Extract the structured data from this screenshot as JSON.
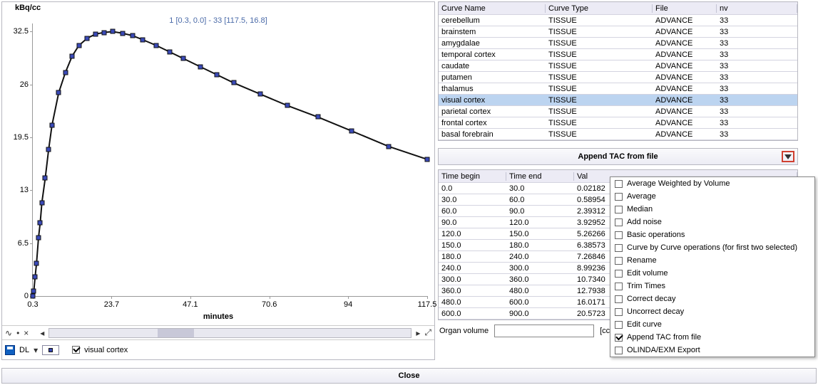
{
  "chart_data": {
    "type": "line",
    "title": "",
    "subtitle": "1 [0.3, 0.0] - 33 [117.5, 16.8]",
    "xlabel": "minutes",
    "ylabel": "kBq/cc",
    "xticks": [
      0.3,
      23.7,
      47.1,
      70.6,
      94.0,
      117.5
    ],
    "yticks": [
      0.0,
      6.5,
      13.0,
      19.5,
      26.0,
      32.5
    ],
    "xlim": [
      0.3,
      117.5
    ],
    "ylim": [
      0.0,
      33.5
    ],
    "series": [
      {
        "name": "visual cortex",
        "x": [
          0.3,
          0.6,
          1.0,
          1.4,
          2.0,
          2.5,
          3.0,
          4.0,
          5.0,
          6.0,
          8.0,
          10.0,
          12.0,
          14.0,
          16.5,
          19.0,
          21.5,
          24.0,
          27.0,
          30.0,
          33.0,
          37.0,
          41.0,
          45.0,
          50.0,
          55.0,
          60.0,
          68.0,
          76.0,
          85.0,
          95.0,
          106.0,
          117.5
        ],
        "y": [
          0.0,
          0.6,
          2.4,
          4.0,
          7.2,
          9.0,
          11.5,
          14.5,
          18.0,
          21.0,
          25.0,
          27.5,
          29.5,
          30.8,
          31.7,
          32.2,
          32.4,
          32.5,
          32.3,
          32.0,
          31.5,
          30.8,
          30.0,
          29.2,
          28.2,
          27.2,
          26.2,
          24.8,
          23.4,
          22.0,
          20.3,
          18.4,
          16.8
        ]
      }
    ]
  },
  "legend": {
    "series_label": "visual cortex",
    "dl_label": "DL"
  },
  "curves_table": {
    "headers": [
      "Curve Name",
      "Curve Type",
      "File",
      "nv"
    ],
    "rows": [
      {
        "name": "cerebellum",
        "type": "TISSUE",
        "file": "ADVANCE",
        "nv": "33",
        "sel": false
      },
      {
        "name": "brainstem",
        "type": "TISSUE",
        "file": "ADVANCE",
        "nv": "33",
        "sel": false
      },
      {
        "name": "amygdalae",
        "type": "TISSUE",
        "file": "ADVANCE",
        "nv": "33",
        "sel": false
      },
      {
        "name": "temporal cortex",
        "type": "TISSUE",
        "file": "ADVANCE",
        "nv": "33",
        "sel": false
      },
      {
        "name": "caudate",
        "type": "TISSUE",
        "file": "ADVANCE",
        "nv": "33",
        "sel": false
      },
      {
        "name": "putamen",
        "type": "TISSUE",
        "file": "ADVANCE",
        "nv": "33",
        "sel": false
      },
      {
        "name": "thalamus",
        "type": "TISSUE",
        "file": "ADVANCE",
        "nv": "33",
        "sel": false
      },
      {
        "name": "visual cortex",
        "type": "TISSUE",
        "file": "ADVANCE",
        "nv": "33",
        "sel": true
      },
      {
        "name": "parietal cortex",
        "type": "TISSUE",
        "file": "ADVANCE",
        "nv": "33",
        "sel": false
      },
      {
        "name": "frontal cortex",
        "type": "TISSUE",
        "file": "ADVANCE",
        "nv": "33",
        "sel": false
      },
      {
        "name": "basal forebrain",
        "type": "TISSUE",
        "file": "ADVANCE",
        "nv": "33",
        "sel": false
      }
    ]
  },
  "append_button": "Append TAC from file",
  "times_table": {
    "headers": [
      "Time begin",
      "Time end",
      "Val"
    ],
    "rows": [
      {
        "b": "0.0",
        "e": "30.0",
        "v": "0.02182"
      },
      {
        "b": "30.0",
        "e": "60.0",
        "v": "0.58954"
      },
      {
        "b": "60.0",
        "e": "90.0",
        "v": "2.39312"
      },
      {
        "b": "90.0",
        "e": "120.0",
        "v": "3.92952"
      },
      {
        "b": "120.0",
        "e": "150.0",
        "v": "5.26266"
      },
      {
        "b": "150.0",
        "e": "180.0",
        "v": "6.38573"
      },
      {
        "b": "180.0",
        "e": "240.0",
        "v": "7.26846"
      },
      {
        "b": "240.0",
        "e": "300.0",
        "v": "8.99236"
      },
      {
        "b": "300.0",
        "e": "360.0",
        "v": "10.7340"
      },
      {
        "b": "360.0",
        "e": "480.0",
        "v": "12.7938"
      },
      {
        "b": "480.0",
        "e": "600.0",
        "v": "16.0171"
      },
      {
        "b": "600.0",
        "e": "900.0",
        "v": "20.5723"
      }
    ]
  },
  "volume": {
    "label": "Organ volume",
    "value": "",
    "unit": "[ccm"
  },
  "close_label": "Close",
  "menu": {
    "items": [
      {
        "label": "Average Weighted by Volume",
        "on": false
      },
      {
        "label": "Average",
        "on": false
      },
      {
        "label": "Median",
        "on": false
      },
      {
        "label": "Add noise",
        "on": false
      },
      {
        "label": "Basic operations",
        "on": false
      },
      {
        "label": "Curve by Curve operations (for first two selected)",
        "on": false
      },
      {
        "label": "Rename",
        "on": false
      },
      {
        "label": "Edit volume",
        "on": false
      },
      {
        "label": "Trim Times",
        "on": false
      },
      {
        "label": "Correct decay",
        "on": false
      },
      {
        "label": "Uncorrect decay",
        "on": false
      },
      {
        "label": "Edit curve",
        "on": false
      },
      {
        "label": "Append TAC from file",
        "on": true
      },
      {
        "label": "OLINDA/EXM Export",
        "on": false
      }
    ]
  }
}
